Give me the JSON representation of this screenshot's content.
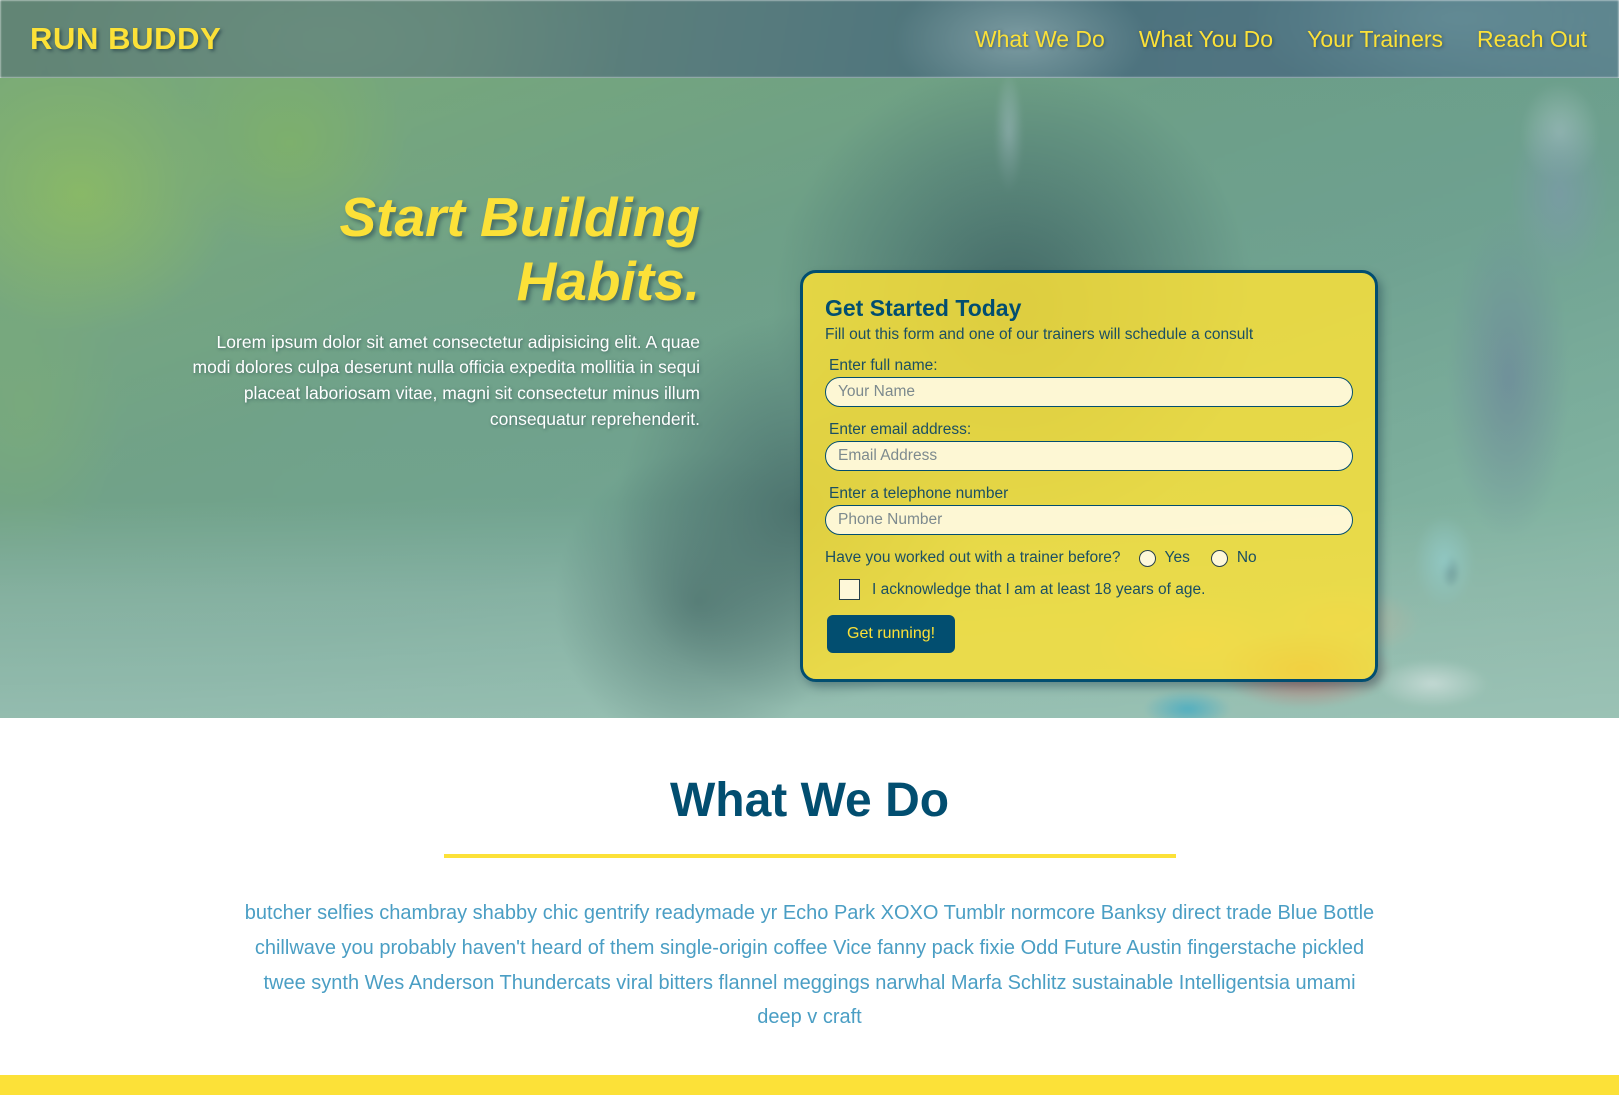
{
  "header": {
    "brand": "RUN BUDDY",
    "nav": [
      {
        "label": "What We Do",
        "name": "nav-what-we-do"
      },
      {
        "label": "What You Do",
        "name": "nav-what-you-do"
      },
      {
        "label": "Your Trainers",
        "name": "nav-your-trainers"
      },
      {
        "label": "Reach Out",
        "name": "nav-reach-out"
      }
    ]
  },
  "hero": {
    "title_line1": "Start Building",
    "title_line2": "Habits.",
    "subtitle": "Lorem ipsum dolor sit amet consectetur adipisicing elit. A quae modi dolores culpa deserunt nulla officia expedita mollitia in sequi placeat laboriosam vitae, magni sit consectetur minus illum consequatur reprehenderit."
  },
  "form": {
    "title": "Get Started Today",
    "subtitle": "Fill out this form and one of our trainers will schedule a consult",
    "name_label": "Enter full name:",
    "name_placeholder": "Your Name",
    "name_value": "",
    "email_label": "Enter email address:",
    "email_placeholder": "Email Address",
    "email_value": "",
    "phone_label": "Enter a telephone number",
    "phone_placeholder": "Phone Number",
    "phone_value": "",
    "radio_question": "Have you worked out with a trainer before?",
    "radio_yes": "Yes",
    "radio_no": "No",
    "checkbox_label": "I acknowledge that I am at least 18 years of age.",
    "submit_label": "Get running!"
  },
  "what_we_do": {
    "title": "What We Do",
    "body": "butcher selfies chambray shabby chic gentrify readymade yr Echo Park XOXO Tumblr normcore Banksy direct trade Blue Bottle chillwave you probably haven't heard of them single-origin coffee Vice fanny pack fixie Odd Future Austin fingerstache pickled twee synth Wes Anderson Thundercats viral bitters flannel meggings narwhal Marfa Schlitz sustainable Intelligentsia umami deep v craft"
  },
  "colors": {
    "yellow": "#fce138",
    "dark_blue": "#024e70",
    "body_teal": "#4a9ec4",
    "input_cream": "#fffae1"
  }
}
